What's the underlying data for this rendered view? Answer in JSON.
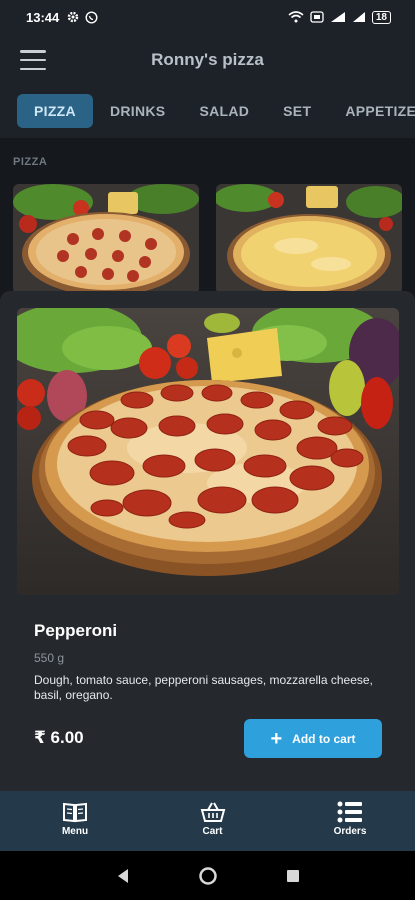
{
  "status_bar": {
    "time": "13:44",
    "battery": "18"
  },
  "header": {
    "title": "Ronny's pizza"
  },
  "tabs": [
    {
      "label": "PIZZA",
      "active": true
    },
    {
      "label": "DRINKS",
      "active": false
    },
    {
      "label": "SALAD",
      "active": false
    },
    {
      "label": "SET",
      "active": false
    },
    {
      "label": "APPETIZER",
      "active": false
    }
  ],
  "section": {
    "label": "PIZZA"
  },
  "product": {
    "name": "Pepperoni",
    "weight": "550 g",
    "description": "Dough, tomato sauce, pepperoni sausages, mozzarella cheese, basil, oregano.",
    "price": "₹ 6.00",
    "add_label": "Add to cart"
  },
  "bottom_nav": [
    {
      "label": "Menu",
      "icon": "book-icon"
    },
    {
      "label": "Cart",
      "icon": "basket-icon"
    },
    {
      "label": "Orders",
      "icon": "list-icon"
    }
  ],
  "colors": {
    "accent": "#2ea0dc",
    "tab_active": "#2a6385",
    "nav_bg": "#243a4a"
  }
}
